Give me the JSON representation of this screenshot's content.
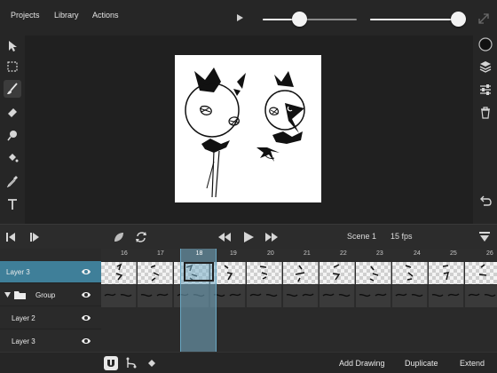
{
  "menu": {
    "projects": "Projects",
    "library": "Library",
    "actions": "Actions"
  },
  "sliders": [
    {
      "name": "brush-size",
      "value": 0.35
    },
    {
      "name": "opacity",
      "value": 0.94
    }
  ],
  "left_tools": [
    {
      "name": "select-tool",
      "icon": "arrow-icon"
    },
    {
      "name": "marquee-tool",
      "icon": "dashed-square-icon"
    },
    {
      "name": "brush-tool",
      "icon": "brush-icon",
      "active": true
    },
    {
      "name": "eraser-tool",
      "icon": "eraser-icon"
    },
    {
      "name": "smudge-tool",
      "icon": "smudge-icon"
    },
    {
      "name": "fill-tool",
      "icon": "bucket-icon"
    },
    {
      "name": "eyedropper-tool",
      "icon": "eyedropper-icon"
    },
    {
      "name": "text-tool",
      "icon": "text-icon"
    }
  ],
  "right_tools": [
    {
      "name": "color-swatch",
      "color": "#111111"
    },
    {
      "name": "layers-button",
      "icon": "layers-icon"
    },
    {
      "name": "adjust-button",
      "icon": "sliders-icon"
    },
    {
      "name": "trash-button",
      "icon": "trash-icon"
    },
    {
      "name": "undo-button",
      "icon": "undo-icon"
    }
  ],
  "playback": {
    "scene": "Scene 1",
    "fps": "15 fps"
  },
  "timeline": {
    "frame_numbers": [
      "16",
      "17",
      "18",
      "19",
      "20",
      "21",
      "22",
      "23",
      "24",
      "25",
      "26"
    ],
    "current_frame": "18",
    "layers": [
      {
        "name": "Layer 3",
        "selected": true,
        "indent": 0
      },
      {
        "name": "Group",
        "selected": false,
        "indent": 0,
        "is_group": true
      },
      {
        "name": "Layer 2",
        "selected": false,
        "indent": 1
      },
      {
        "name": "Layer 3",
        "selected": false,
        "indent": 1
      }
    ]
  },
  "bottom": {
    "add_drawing": "Add Drawing",
    "duplicate": "Duplicate",
    "extend": "Extend"
  },
  "colors": {
    "accent": "#3f7f99",
    "playhead": "#78afc8",
    "background": "#2a2a2a"
  }
}
